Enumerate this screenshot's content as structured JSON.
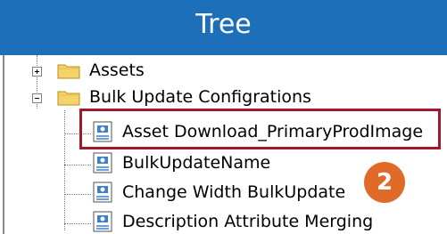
{
  "header": {
    "title": "Tree"
  },
  "tree": {
    "nodes": [
      {
        "label": "Assets",
        "type": "folder",
        "expander": "+"
      },
      {
        "label": "Bulk Update Configrations",
        "type": "folder",
        "expander": "-"
      },
      {
        "label": "Asset Download_PrimaryProdImage",
        "type": "document",
        "highlighted": true
      },
      {
        "label": "BulkUpdateName",
        "type": "document"
      },
      {
        "label": "Change Width BulkUpdate",
        "type": "document"
      },
      {
        "label": "Description Attribute Merging",
        "type": "document"
      }
    ]
  },
  "annotation": {
    "badge_number": "2",
    "highlight_color": "#a0182a",
    "badge_color": "#e06a28"
  },
  "colors": {
    "header_bg": "#1e6fba"
  }
}
